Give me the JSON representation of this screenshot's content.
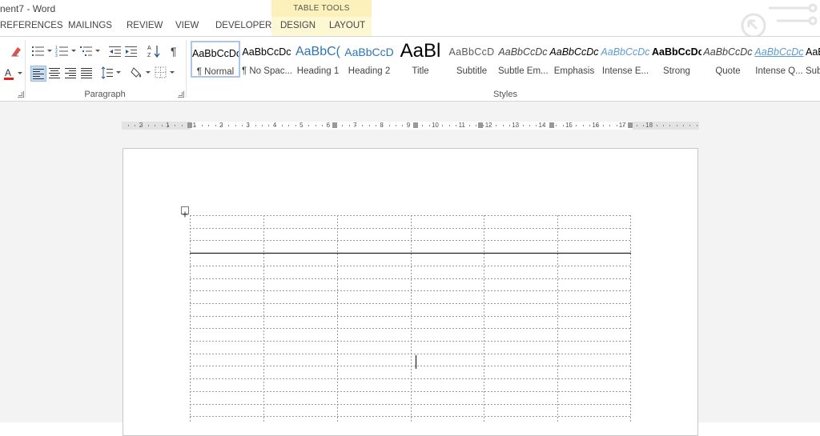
{
  "window": {
    "title": "nent7 - Word"
  },
  "contextual": {
    "group_label": "TABLE TOOLS"
  },
  "tabs": [
    {
      "label": "REFERENCES"
    },
    {
      "label": "MAILINGS"
    },
    {
      "label": "REVIEW"
    },
    {
      "label": "VIEW"
    },
    {
      "label": "DEVELOPER"
    },
    {
      "label": "DESIGN"
    },
    {
      "label": "LAYOUT"
    }
  ],
  "groups": {
    "paragraph": "Paragraph",
    "styles": "Styles"
  },
  "styles": [
    {
      "sample": "AaBbCcDc",
      "name": "¶ Normal"
    },
    {
      "sample": "AaBbCcDc",
      "name": "¶ No Spac..."
    },
    {
      "sample": "AaBbC(",
      "name": "Heading 1"
    },
    {
      "sample": "AaBbCcD",
      "name": "Heading 2"
    },
    {
      "sample": "AaBl",
      "name": "Title"
    },
    {
      "sample": "AaBbCcD",
      "name": "Subtitle"
    },
    {
      "sample": "AaBbCcDc",
      "name": "Subtle Em..."
    },
    {
      "sample": "AaBbCcDc",
      "name": "Emphasis"
    },
    {
      "sample": "AaBbCcDc",
      "name": "Intense E..."
    },
    {
      "sample": "AaBbCcDc",
      "name": "Strong"
    },
    {
      "sample": "AaBbCcDc",
      "name": "Quote"
    },
    {
      "sample": "AaBbCcDc",
      "name": "Intense Q..."
    },
    {
      "sample": "AaBb",
      "name": "Subt"
    }
  ],
  "ruler": {
    "labels": [
      "2",
      "1",
      "1",
      "2",
      "3",
      "4",
      "5",
      "6",
      "7",
      "8",
      "9",
      "10",
      "11",
      "12",
      "13",
      "14",
      "15",
      "16",
      "17",
      "18"
    ]
  },
  "table": {
    "columns": 6,
    "rows": 16
  },
  "colors": {
    "accent": "#2b579a",
    "contextual_tab": "#fdf1bb",
    "font_color_bar": "#e02020"
  }
}
